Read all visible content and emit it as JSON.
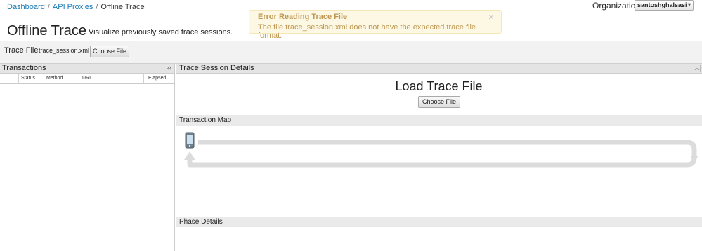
{
  "breadcrumb": {
    "items": [
      "Dashboard",
      "API Proxies",
      "Offline Trace"
    ],
    "separator": "/"
  },
  "header": {
    "title": "Offline Trace",
    "subtitle": "Visualize previously saved trace sessions."
  },
  "error": {
    "title": "Error Reading Trace File",
    "message": "The file trace_session.xml does not have the expected trace file format.",
    "close_glyph": "×"
  },
  "organization": {
    "label": "Organization",
    "selected": "santoshghalsasi",
    "caret": "▾"
  },
  "trace_file": {
    "label": "Trace File",
    "file_name": "trace_session.xml",
    "button": "Choose File"
  },
  "transactions": {
    "title": "Transactions",
    "collapse_glyph": "‹‹",
    "columns": [
      "Status",
      "Method",
      "URI",
      "Elapsed"
    ]
  },
  "session": {
    "title": "Trace Session Details",
    "expand_glyph": "︽",
    "load_title": "Load Trace File",
    "load_button": "Choose File",
    "map_title": "Transaction Map",
    "phase_title": "Phase Details"
  },
  "colors": {
    "link": "#1a7ab7",
    "error_text": "#c09853",
    "error_bg": "#fcf8e3",
    "panel_header": "#e4e4e4",
    "flow_track": "#dcdcdc"
  },
  "icons": {
    "client": "mobile-device-icon",
    "flow": "request-response-flow"
  }
}
